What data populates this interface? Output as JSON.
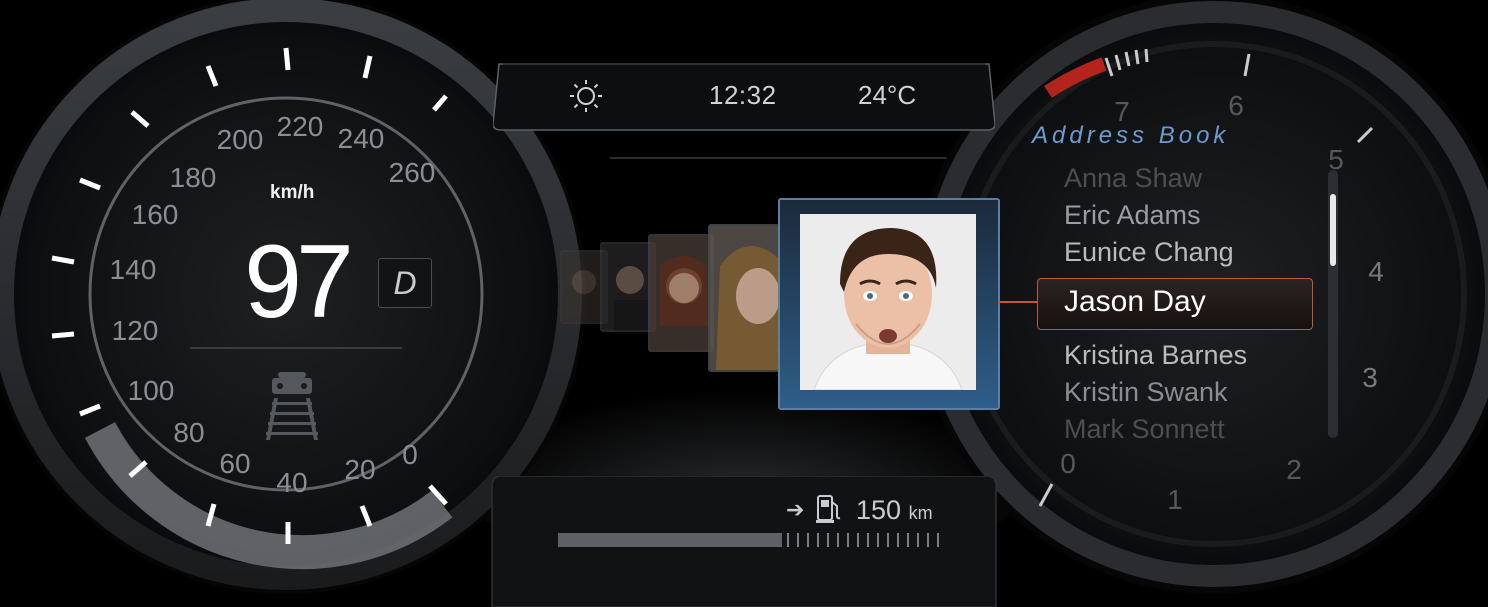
{
  "status_bar": {
    "weather_icon": "sun-icon",
    "time": "12:32",
    "temperature": "24°C"
  },
  "speedometer": {
    "unit": "km/h",
    "speed": "97",
    "speed_value": 97,
    "gear": "D",
    "lane_assist_icon": "lane-assist-icon",
    "tick_labels": [
      "0",
      "20",
      "40",
      "60",
      "80",
      "100",
      "120",
      "140",
      "160",
      "180",
      "200",
      "220",
      "240",
      "260"
    ]
  },
  "address_book": {
    "title": "Address Book",
    "contacts": [
      "Anna Shaw",
      "Eric Adams",
      "Eunice Chang",
      "Jason Day",
      "Kristina Barnes",
      "Kristin Swank",
      "Mark Sonnett"
    ],
    "selected_contact": "Jason Day"
  },
  "tachometer": {
    "tick_labels": [
      "0",
      "1",
      "2",
      "3",
      "4",
      "5",
      "6",
      "7"
    ]
  },
  "fuel": {
    "arrow_icon": "arrow-right-icon",
    "pump_icon": "fuel-pump-icon",
    "range_value": "150",
    "range_unit": "km",
    "level": 0.59
  },
  "colors": {
    "accent_blue": "#6c9bd1",
    "selection_border": "#c3573e",
    "redline": "#b3241c"
  }
}
